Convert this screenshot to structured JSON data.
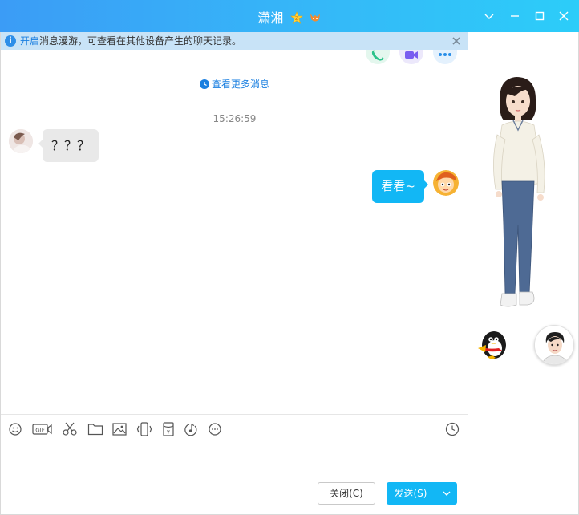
{
  "window": {
    "title": "潇湘",
    "controls": [
      "chevron-down-icon",
      "minimize-icon",
      "maximize-icon",
      "close-icon"
    ]
  },
  "notice": {
    "link_text": "开启",
    "text": "消息漫游，可查看在其他设备产生的聊天记录。"
  },
  "chat": {
    "more_history": "查看更多消息",
    "timestamp": "15:26:59",
    "messages": [
      {
        "side": "left",
        "text": "？？？"
      },
      {
        "side": "right",
        "text": "看看~"
      }
    ]
  },
  "toolbar": {
    "icons": [
      "emoji-icon",
      "gif-icon",
      "scissors-icon",
      "folder-icon",
      "image-icon",
      "shake-icon",
      "red-packet-icon",
      "music-icon",
      "more-icon",
      "history-clock-icon"
    ]
  },
  "buttons": {
    "close_label": "关闭(C)",
    "send_label": "发送(S)"
  },
  "colors": {
    "accent": "#12b7f5",
    "notice_bg": "#c8e3f7",
    "link": "#1a7fe0"
  }
}
